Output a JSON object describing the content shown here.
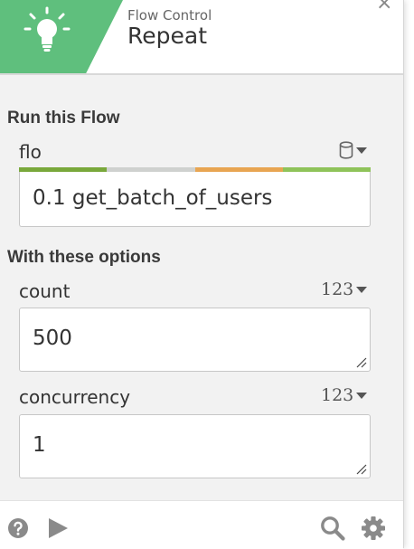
{
  "header": {
    "subtitle": "Flow Control",
    "title": "Repeat",
    "icon": "lightbulb-icon",
    "accent_color": "#5fbf7d",
    "close_glyph": "×"
  },
  "run_section": {
    "title": "Run this Flow",
    "field_label": "flo",
    "type_icon": "database-icon",
    "value": "0.1 get_batch_of_users",
    "color_bar": [
      "#79a83b",
      "#cfd1cf",
      "#e8a552",
      "#8fc35a"
    ]
  },
  "options_section": {
    "title": "With these options",
    "fields": [
      {
        "label": "count",
        "type": "123",
        "value": "500"
      },
      {
        "label": "concurrency",
        "type": "123",
        "value": "1"
      }
    ]
  },
  "footer": {
    "left_icons": [
      "help-icon",
      "play-icon"
    ],
    "right_icons": [
      "search-icon",
      "settings-icon"
    ]
  }
}
